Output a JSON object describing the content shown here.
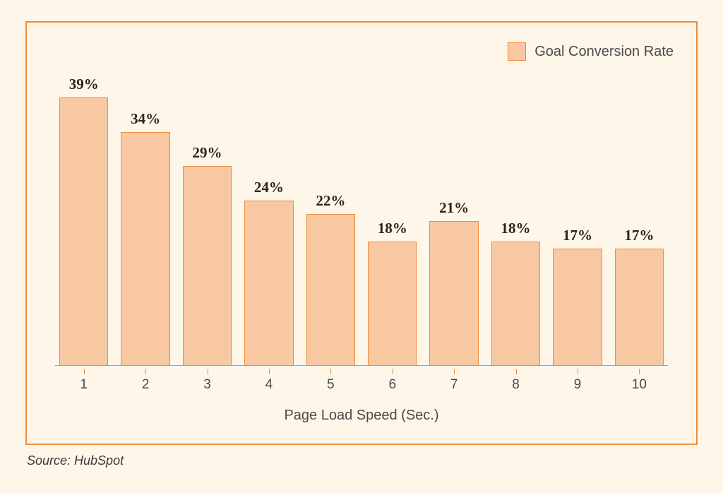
{
  "chart_data": {
    "type": "bar",
    "categories": [
      "1",
      "2",
      "3",
      "4",
      "5",
      "6",
      "7",
      "8",
      "9",
      "10"
    ],
    "values": [
      39,
      34,
      29,
      24,
      22,
      18,
      21,
      18,
      17,
      17
    ],
    "value_suffix": "%",
    "xlabel": "Page Load Speed (Sec.)",
    "ylabel": "",
    "ylim": [
      0,
      45
    ],
    "series_name": "Goal Conversion Rate"
  },
  "legend": {
    "label": "Goal Conversion Rate"
  },
  "source_text": "Source: HubSpot"
}
